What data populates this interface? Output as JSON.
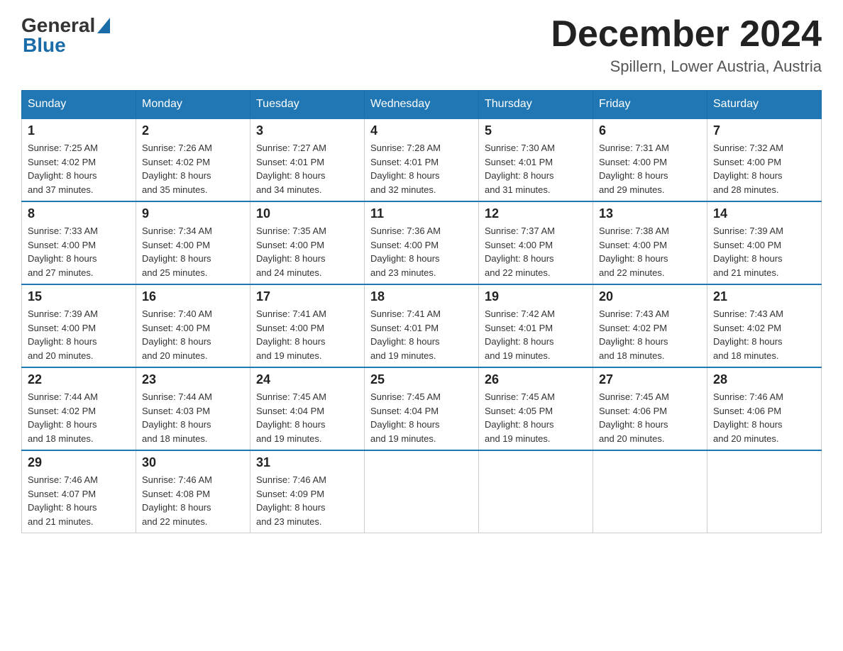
{
  "logo": {
    "general": "General",
    "blue": "Blue"
  },
  "title": {
    "month_year": "December 2024",
    "location": "Spillern, Lower Austria, Austria"
  },
  "headers": [
    "Sunday",
    "Monday",
    "Tuesday",
    "Wednesday",
    "Thursday",
    "Friday",
    "Saturday"
  ],
  "weeks": [
    [
      {
        "day": "1",
        "sunrise": "7:25 AM",
        "sunset": "4:02 PM",
        "daylight": "8 hours and 37 minutes."
      },
      {
        "day": "2",
        "sunrise": "7:26 AM",
        "sunset": "4:02 PM",
        "daylight": "8 hours and 35 minutes."
      },
      {
        "day": "3",
        "sunrise": "7:27 AM",
        "sunset": "4:01 PM",
        "daylight": "8 hours and 34 minutes."
      },
      {
        "day": "4",
        "sunrise": "7:28 AM",
        "sunset": "4:01 PM",
        "daylight": "8 hours and 32 minutes."
      },
      {
        "day": "5",
        "sunrise": "7:30 AM",
        "sunset": "4:01 PM",
        "daylight": "8 hours and 31 minutes."
      },
      {
        "day": "6",
        "sunrise": "7:31 AM",
        "sunset": "4:00 PM",
        "daylight": "8 hours and 29 minutes."
      },
      {
        "day": "7",
        "sunrise": "7:32 AM",
        "sunset": "4:00 PM",
        "daylight": "8 hours and 28 minutes."
      }
    ],
    [
      {
        "day": "8",
        "sunrise": "7:33 AM",
        "sunset": "4:00 PM",
        "daylight": "8 hours and 27 minutes."
      },
      {
        "day": "9",
        "sunrise": "7:34 AM",
        "sunset": "4:00 PM",
        "daylight": "8 hours and 25 minutes."
      },
      {
        "day": "10",
        "sunrise": "7:35 AM",
        "sunset": "4:00 PM",
        "daylight": "8 hours and 24 minutes."
      },
      {
        "day": "11",
        "sunrise": "7:36 AM",
        "sunset": "4:00 PM",
        "daylight": "8 hours and 23 minutes."
      },
      {
        "day": "12",
        "sunrise": "7:37 AM",
        "sunset": "4:00 PM",
        "daylight": "8 hours and 22 minutes."
      },
      {
        "day": "13",
        "sunrise": "7:38 AM",
        "sunset": "4:00 PM",
        "daylight": "8 hours and 22 minutes."
      },
      {
        "day": "14",
        "sunrise": "7:39 AM",
        "sunset": "4:00 PM",
        "daylight": "8 hours and 21 minutes."
      }
    ],
    [
      {
        "day": "15",
        "sunrise": "7:39 AM",
        "sunset": "4:00 PM",
        "daylight": "8 hours and 20 minutes."
      },
      {
        "day": "16",
        "sunrise": "7:40 AM",
        "sunset": "4:00 PM",
        "daylight": "8 hours and 20 minutes."
      },
      {
        "day": "17",
        "sunrise": "7:41 AM",
        "sunset": "4:00 PM",
        "daylight": "8 hours and 19 minutes."
      },
      {
        "day": "18",
        "sunrise": "7:41 AM",
        "sunset": "4:01 PM",
        "daylight": "8 hours and 19 minutes."
      },
      {
        "day": "19",
        "sunrise": "7:42 AM",
        "sunset": "4:01 PM",
        "daylight": "8 hours and 19 minutes."
      },
      {
        "day": "20",
        "sunrise": "7:43 AM",
        "sunset": "4:02 PM",
        "daylight": "8 hours and 18 minutes."
      },
      {
        "day": "21",
        "sunrise": "7:43 AM",
        "sunset": "4:02 PM",
        "daylight": "8 hours and 18 minutes."
      }
    ],
    [
      {
        "day": "22",
        "sunrise": "7:44 AM",
        "sunset": "4:02 PM",
        "daylight": "8 hours and 18 minutes."
      },
      {
        "day": "23",
        "sunrise": "7:44 AM",
        "sunset": "4:03 PM",
        "daylight": "8 hours and 18 minutes."
      },
      {
        "day": "24",
        "sunrise": "7:45 AM",
        "sunset": "4:04 PM",
        "daylight": "8 hours and 19 minutes."
      },
      {
        "day": "25",
        "sunrise": "7:45 AM",
        "sunset": "4:04 PM",
        "daylight": "8 hours and 19 minutes."
      },
      {
        "day": "26",
        "sunrise": "7:45 AM",
        "sunset": "4:05 PM",
        "daylight": "8 hours and 19 minutes."
      },
      {
        "day": "27",
        "sunrise": "7:45 AM",
        "sunset": "4:06 PM",
        "daylight": "8 hours and 20 minutes."
      },
      {
        "day": "28",
        "sunrise": "7:46 AM",
        "sunset": "4:06 PM",
        "daylight": "8 hours and 20 minutes."
      }
    ],
    [
      {
        "day": "29",
        "sunrise": "7:46 AM",
        "sunset": "4:07 PM",
        "daylight": "8 hours and 21 minutes."
      },
      {
        "day": "30",
        "sunrise": "7:46 AM",
        "sunset": "4:08 PM",
        "daylight": "8 hours and 22 minutes."
      },
      {
        "day": "31",
        "sunrise": "7:46 AM",
        "sunset": "4:09 PM",
        "daylight": "8 hours and 23 minutes."
      },
      null,
      null,
      null,
      null
    ]
  ],
  "labels": {
    "sunrise": "Sunrise:",
    "sunset": "Sunset:",
    "daylight": "Daylight:"
  }
}
